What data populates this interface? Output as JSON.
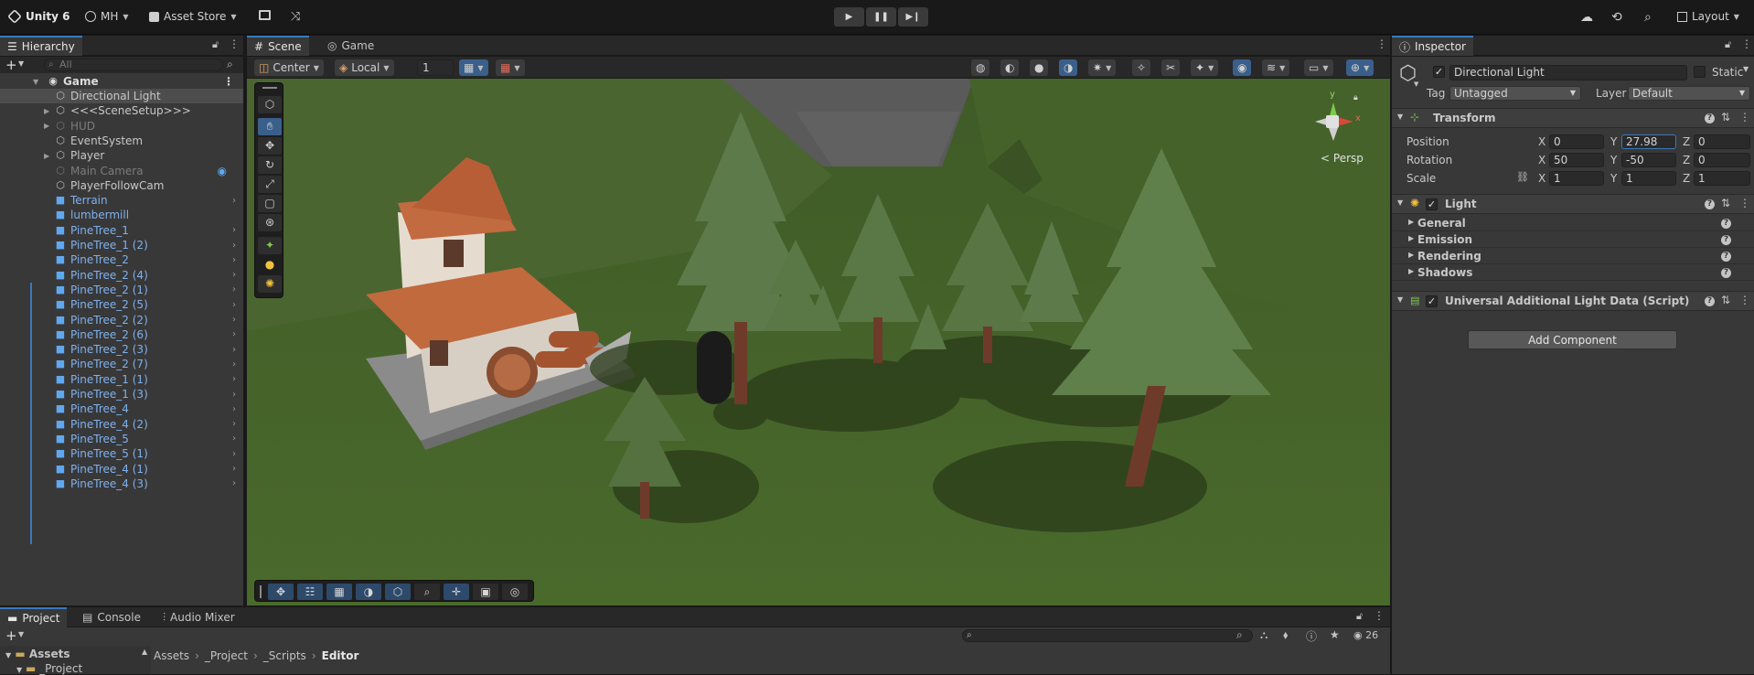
{
  "toolbar": {
    "product": "Unity 6",
    "account": "MH",
    "asset_store": "Asset Store",
    "layout": "Layout"
  },
  "hierarchy": {
    "tab": "Hierarchy",
    "search_placeholder": "All",
    "scene_name": "Game",
    "items": [
      {
        "label": "Directional Light",
        "kind": "normal",
        "selected": true
      },
      {
        "label": "<<<SceneSetup>>>",
        "kind": "normal",
        "expandable": true
      },
      {
        "label": "HUD",
        "kind": "grey",
        "expandable": true
      },
      {
        "label": "EventSystem",
        "kind": "normal"
      },
      {
        "label": "Player",
        "kind": "normal",
        "expandable": true
      },
      {
        "label": "Main Camera",
        "kind": "grey"
      },
      {
        "label": "PlayerFollowCam",
        "kind": "normal"
      },
      {
        "label": "Terrain",
        "kind": "prefab",
        "arrow": true
      },
      {
        "label": "lumbermill",
        "kind": "prefab"
      },
      {
        "label": "PineTree_1",
        "kind": "prefab",
        "arrow": true
      },
      {
        "label": "PineTree_1 (2)",
        "kind": "prefab",
        "arrow": true
      },
      {
        "label": "PineTree_2",
        "kind": "prefab",
        "arrow": true
      },
      {
        "label": "PineTree_2 (4)",
        "kind": "prefab",
        "arrow": true
      },
      {
        "label": "PineTree_2 (1)",
        "kind": "prefab",
        "arrow": true
      },
      {
        "label": "PineTree_2 (5)",
        "kind": "prefab",
        "arrow": true
      },
      {
        "label": "PineTree_2 (2)",
        "kind": "prefab",
        "arrow": true
      },
      {
        "label": "PineTree_2 (6)",
        "kind": "prefab",
        "arrow": true
      },
      {
        "label": "PineTree_2 (3)",
        "kind": "prefab",
        "arrow": true
      },
      {
        "label": "PineTree_2 (7)",
        "kind": "prefab",
        "arrow": true
      },
      {
        "label": "PineTree_1 (1)",
        "kind": "prefab",
        "arrow": true
      },
      {
        "label": "PineTree_1 (3)",
        "kind": "prefab",
        "arrow": true
      },
      {
        "label": "PineTree_4",
        "kind": "prefab",
        "arrow": true
      },
      {
        "label": "PineTree_4 (2)",
        "kind": "prefab",
        "arrow": true
      },
      {
        "label": "PineTree_5",
        "kind": "prefab",
        "arrow": true
      },
      {
        "label": "PineTree_5 (1)",
        "kind": "prefab",
        "arrow": true
      },
      {
        "label": "PineTree_4 (1)",
        "kind": "prefab",
        "arrow": true
      },
      {
        "label": "PineTree_4 (3)",
        "kind": "prefab",
        "arrow": true
      }
    ]
  },
  "scene": {
    "tabs": [
      "Scene",
      "Game"
    ],
    "pivot": "Center",
    "space": "Local",
    "grid_value": "1",
    "persp": "Persp",
    "gizmo_y": "y",
    "gizmo_x": "x"
  },
  "inspector": {
    "tab": "Inspector",
    "object_name": "Directional Light",
    "static_label": "Static",
    "tag_label": "Tag",
    "tag_value": "Untagged",
    "layer_label": "Layer",
    "layer_value": "Default",
    "transform": {
      "title": "Transform",
      "position_label": "Position",
      "rotation_label": "Rotation",
      "scale_label": "Scale",
      "position": {
        "x": "0",
        "y": "27.98",
        "z": "0"
      },
      "rotation": {
        "x": "50",
        "y": "-50",
        "z": "0"
      },
      "scale": {
        "x": "1",
        "y": "1",
        "z": "1"
      }
    },
    "light": {
      "title": "Light",
      "sections": [
        "General",
        "Emission",
        "Rendering",
        "Shadows"
      ]
    },
    "script_title": "Universal Additional Light Data (Script)",
    "add_component": "Add Component"
  },
  "bottom": {
    "tabs": [
      "Project",
      "Console",
      "Audio Mixer"
    ],
    "assets_root": "Assets",
    "assets_child": "_Project",
    "breadcrumb": [
      "Assets",
      "_Project",
      "_Scripts",
      "Editor"
    ],
    "hidden_count": "26"
  },
  "colors": {
    "accent": "#3a79bb",
    "prefab_text": "#7fb1ee",
    "selection": "#4d4d4d"
  }
}
